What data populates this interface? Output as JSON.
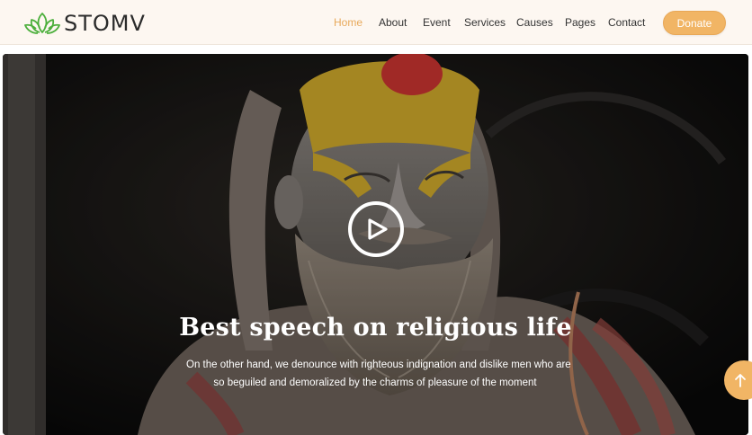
{
  "brand": {
    "name": "STOMV",
    "logo_icon": "lotus-icon",
    "logo_color": "#4caf3c"
  },
  "nav": {
    "items": [
      {
        "label": "Home",
        "active": true
      },
      {
        "label": "About",
        "active": false
      },
      {
        "label": "Event",
        "active": false
      },
      {
        "label": "Services",
        "active": false
      },
      {
        "label": "Causes",
        "active": false
      },
      {
        "label": "Pages",
        "active": false
      },
      {
        "label": "Contact",
        "active": false
      }
    ],
    "donate_label": "Donate"
  },
  "hero": {
    "title": "Best speech on religious life",
    "description_lines": [
      "On the other hand, we denounce with righteous indignation and dislike men who are",
      "so beguiled and demoralized by the charms of pleasure of the moment"
    ],
    "play_icon": "play-circle-icon"
  },
  "scroll_top_icon": "arrow-up-icon",
  "colors": {
    "accent": "#f1b565",
    "nav_active": "#e8a95b",
    "header_bg": "#fdf7f1"
  }
}
